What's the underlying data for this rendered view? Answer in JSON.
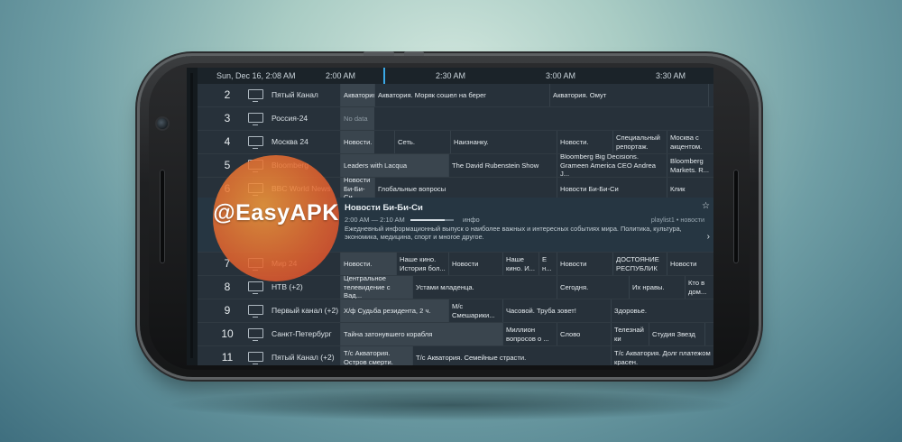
{
  "header": {
    "datetime": "Sun, Dec 16, 2:08 AM",
    "time_slots": [
      "2:00 AM",
      "2:30 AM",
      "3:00 AM",
      "3:30 AM"
    ]
  },
  "channels": [
    {
      "num": "2",
      "name": "Пятый Канал",
      "programs": [
        "Акватория",
        "Акватория. Моряк сошел на берег",
        "Акватория. Омут",
        ""
      ]
    },
    {
      "num": "3",
      "name": "Россия-24",
      "programs": [
        "No data"
      ]
    },
    {
      "num": "4",
      "name": "Москва 24",
      "programs": [
        "Новости.",
        "Сеть.",
        "Наизнанку.",
        "Новости.",
        "Специальный репортаж.",
        "Москва с акцентом."
      ]
    },
    {
      "num": "5",
      "name": "Bloomberg",
      "programs": [
        "Leaders with Lacqua",
        "The David Rubenstein Show",
        "Bloomberg Big Decisions. Grameen America CEO Andrea J...",
        "Bloomberg Markets. R..."
      ]
    },
    {
      "num": "6",
      "name": "BBC World News",
      "programs": [
        "Новости Би-Би-Си",
        "Глобальные вопросы",
        "Новости Би-Би-Си",
        "Клик"
      ]
    },
    {
      "num": "7",
      "name": "Мир 24",
      "programs": [
        "Новости.",
        "Наше кино. История бол...",
        "Новости",
        "Наше кино. И...",
        "Е н...",
        "Новости",
        "ДОСТОЯНИЕ РЕСПУБЛИК",
        "Новости"
      ]
    },
    {
      "num": "8",
      "name": "НТВ (+2)",
      "programs": [
        "Центральное телевидение с Вад...",
        "Устами младенца.",
        "Сегодня.",
        "Их нравы.",
        "Кто в дом..."
      ]
    },
    {
      "num": "9",
      "name": "Первый канал (+2)",
      "programs": [
        "Х/ф Судьба резидента, 2 ч.",
        "М/с Смешарики...",
        "Часовой. Труба зовет!",
        "Здоровье."
      ]
    },
    {
      "num": "10",
      "name": "Санкт-Петербург",
      "programs": [
        "Тайна затонувшего корабля",
        "Миллион вопросов о ...",
        "Слово",
        "Телезнай ки",
        "Студия Звезд",
        ""
      ]
    },
    {
      "num": "11",
      "name": "Пятый Канал (+2)",
      "programs": [
        "Т/с Акватория. Остров смерти.",
        "Т/с Акватория. Семейные страсти.",
        "Т/с Акватория. Долг платежом красен."
      ]
    }
  ],
  "details": {
    "title": "Новости Би-Би-Си",
    "time": "2:00 AM — 2:10 AM",
    "progress": 0.8,
    "info": "инфо",
    "source": "playlist1 • новости",
    "description": "Ежедневный информационный выпуск о наиболее важных и интересных событиях мира. Политика, культура, экономика, медицина, спорт и многое другое."
  },
  "watermark": "@EasyAPK"
}
